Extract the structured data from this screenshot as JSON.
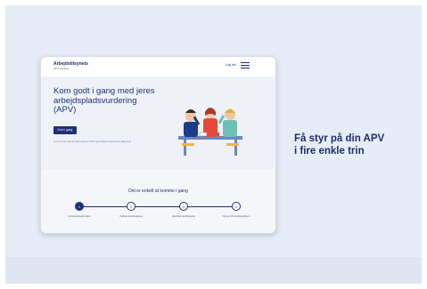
{
  "colors": {
    "primary": "#1c2f78",
    "background": "#e7edf7",
    "hero_bg": "#eef2f8"
  },
  "header": {
    "brand": "Arbejdstilsynets",
    "brand_sub": "APV-værktøj",
    "login_label": "Log ind",
    "menu_icon": "hamburger-menu-icon"
  },
  "hero": {
    "title": "Kom godt i gang med jeres arbejdspladsvurdering (APV)",
    "cta_label": "Kom i gang",
    "note": "Er du ny her, kan du læse mere om APV og hvordan du kommer i gang med"
  },
  "steps": {
    "title": "Det er enkelt at komme i gang",
    "items": [
      {
        "number": "1",
        "label": "Kortlæg arbejdsmiljøet"
      },
      {
        "number": "2",
        "label": "Inddrag medarbejderne"
      },
      {
        "number": "3",
        "label": "Udarbejd handlingsplan"
      },
      {
        "number": "4",
        "label": "Følg op på handlingsplanen"
      }
    ]
  },
  "tagline": {
    "line1": "Få styr på din APV",
    "line2": "i fire enkle trin"
  }
}
